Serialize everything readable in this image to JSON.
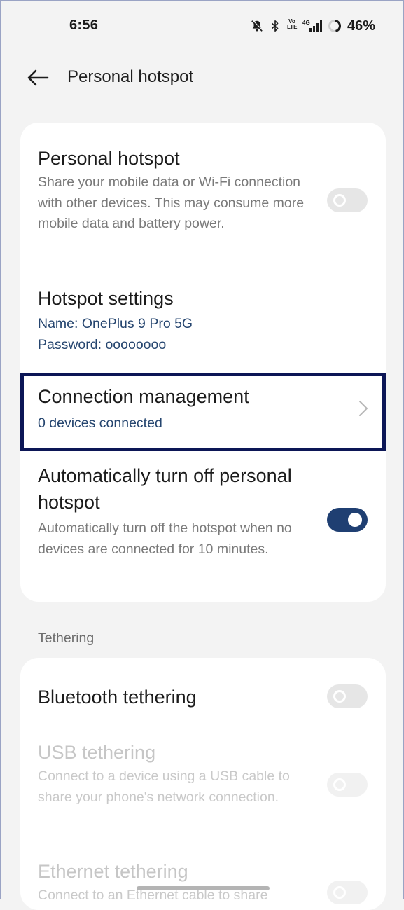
{
  "status_bar": {
    "time": "6:56",
    "volte_label": "Vo LTE",
    "network_label": "4G",
    "battery_percent": "46%"
  },
  "app_bar": {
    "title": "Personal hotspot",
    "back_icon": "arrow-left-icon"
  },
  "hotspot_card": {
    "personal_hotspot": {
      "title": "Personal hotspot",
      "description": "Share your mobile data or Wi-Fi connection with other devices. This may consume more mobile data and battery power.",
      "enabled": false
    },
    "hotspot_settings": {
      "title": "Hotspot settings",
      "name_line": "Name: OnePlus 9 Pro 5G",
      "password_line": "Password: oooooooo"
    },
    "connection_management": {
      "title": "Connection management",
      "subtitle": "0 devices connected",
      "icon": "chevron-right-icon"
    },
    "auto_turn_off": {
      "title": "Automatically turn off personal hotspot",
      "description": "Automatically turn off the hotspot when no devices are connected for 10 minutes.",
      "enabled": true
    }
  },
  "tethering": {
    "section_label": "Tethering",
    "bluetooth": {
      "title": "Bluetooth tethering",
      "enabled": false
    },
    "usb": {
      "title": "USB tethering",
      "description": "Connect to a device using a USB cable to share your phone's network connection.",
      "enabled": false,
      "disabled": true
    },
    "ethernet": {
      "title": "Ethernet tethering",
      "description": "Connect to an Ethernet cable to share",
      "enabled": false,
      "disabled": true
    }
  },
  "colors": {
    "accent": "#1f3f72",
    "link_text": "#25456f",
    "highlight_border": "#0c1656",
    "background": "#f3f3f3",
    "card": "#ffffff"
  }
}
